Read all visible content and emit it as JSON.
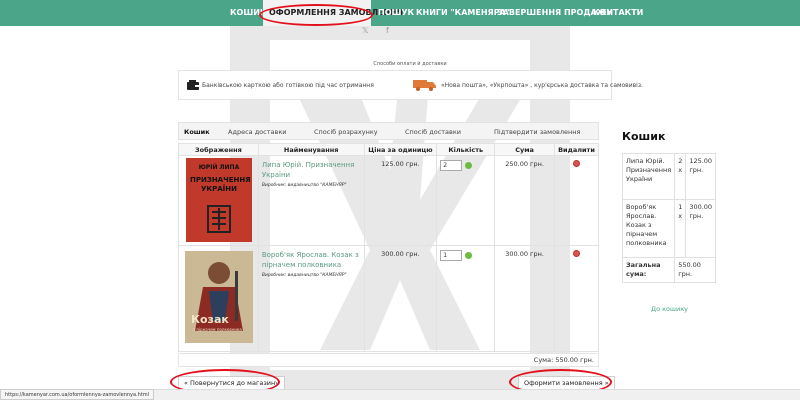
{
  "nav": {
    "items": [
      "КОШИК",
      "ОФОРМЛЕННЯ ЗАМОВЛЕННЯ",
      "ПОШУК",
      "КНИГИ \"КАМЕНЯРА\"",
      "ЗАВЕРШЕННЯ ПРОДАЖУ",
      "КОНТАКТИ"
    ],
    "active": "ОФОРМЛЕННЯ ЗАМОВЛЕННЯ",
    "background_color": "#4aa589"
  },
  "social": {
    "twitter": "twitter-icon",
    "facebook": "facebook-icon",
    "twitter_glyph": "𝕏",
    "facebook_glyph": "f"
  },
  "delivery": {
    "heading": "Способи оплати й доставки",
    "payment": "Банківською карткою або готівкою під час отримання",
    "shipping": "«Нова пошта», «Укрпошта» , кур'єрська доставка та самовивіз."
  },
  "tabs": [
    "Кошик",
    "Адреса доставки",
    "Спосіб розрахунку",
    "Спосіб доставки",
    "Підтвердити замовлення"
  ],
  "cart": {
    "headers": [
      "Зображення",
      "Найменування",
      "Ціна за одиницю",
      "Кількість",
      "Сума",
      "Видалити"
    ],
    "rows": [
      {
        "name": "Липа Юрій. Призначення України",
        "publisher": "Виробник: видавництво \"КАМЕНЯР\"",
        "price": "125.00 грн.",
        "qty": "2",
        "sum": "250.00 грн.",
        "cover": {
          "author": "ЮРІЙ ЛИПА",
          "title": "ПРИЗНАЧЕННЯ УКРАЇНИ"
        }
      },
      {
        "name": "Вороб'як Ярослав. Козак з пірначем полковника",
        "publisher": "Виробник: видавництво \"КАМЕНЯР\"",
        "price": "300.00 грн.",
        "qty": "1",
        "sum": "300.00 грн.",
        "cover": {
          "title": "Козак",
          "subtitle": "з пірначем полковника"
        }
      }
    ],
    "total_partial": "Сума: 550.00 грн."
  },
  "buttons": {
    "back": "« Повернутися до магазину",
    "checkout": "Оформити замовлення »"
  },
  "sidebar": {
    "title": "Кошик",
    "items": [
      {
        "name": "Липа Юрій. Призначення України",
        "qty": "2 x",
        "price": "125.00 грн."
      },
      {
        "name": "Вороб'як Ярослав. Козак з пірначем полковника",
        "qty": "1 x",
        "price": "300.00 грн."
      }
    ],
    "total_label": "Загальна сума:",
    "total_value": "550.00 грн.",
    "cart_link": "До кошику"
  },
  "status_url": "https://kamenyar.com.ua/oformlennya-zamovlennya.html"
}
